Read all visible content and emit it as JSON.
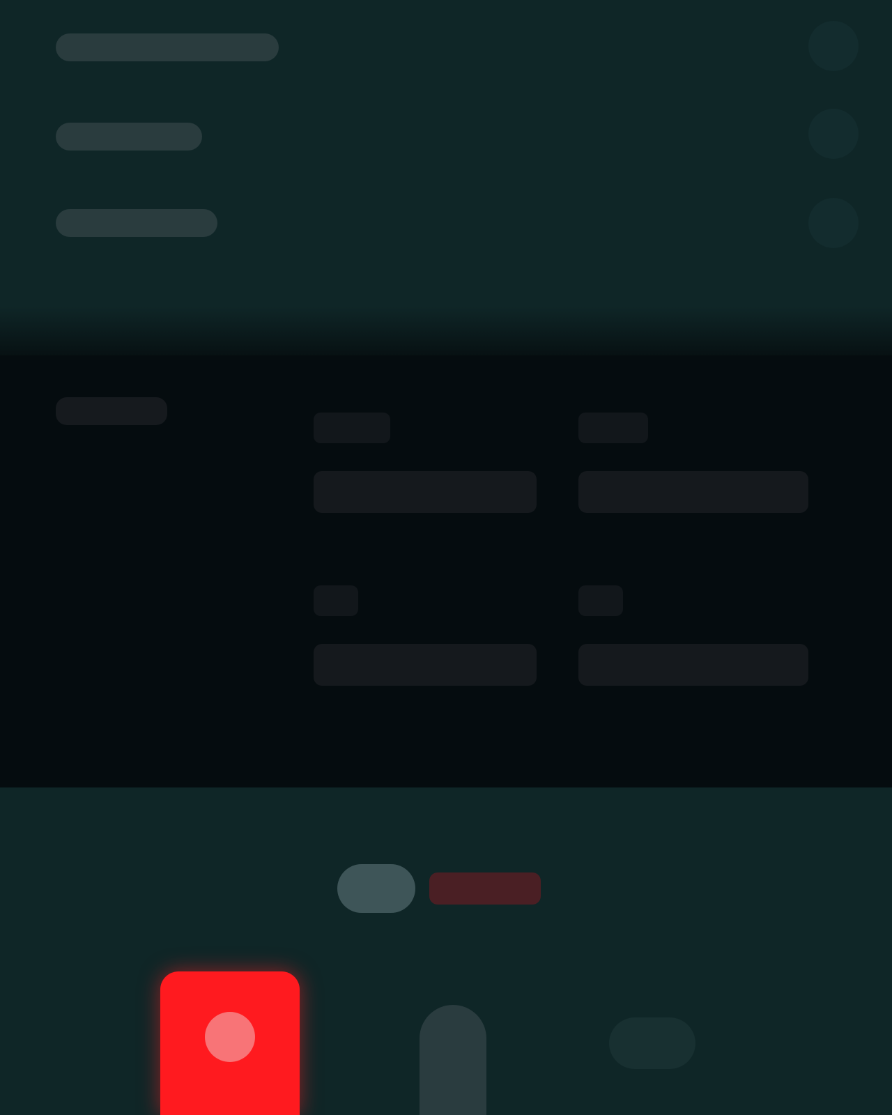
{
  "nav": {
    "items": [
      {
        "label": ""
      },
      {
        "label": ""
      },
      {
        "label": ""
      }
    ]
  },
  "side_icons": [
    "avatar-icon",
    "settings-icon",
    "info-icon"
  ],
  "info": {
    "heading": "",
    "cells": [
      {
        "label": "",
        "value": ""
      },
      {
        "label": "",
        "value": ""
      },
      {
        "label": "",
        "value": ""
      },
      {
        "label": "",
        "value": ""
      }
    ]
  },
  "brand": {
    "mark": "",
    "text": ""
  },
  "controls": {
    "record_icon": "record-icon",
    "mic_icon": "microphone-icon",
    "more_icon": "more-icon"
  },
  "colors": {
    "background": "#0f2627",
    "panel": "#050c0f",
    "accent": "#ff1a1f"
  }
}
